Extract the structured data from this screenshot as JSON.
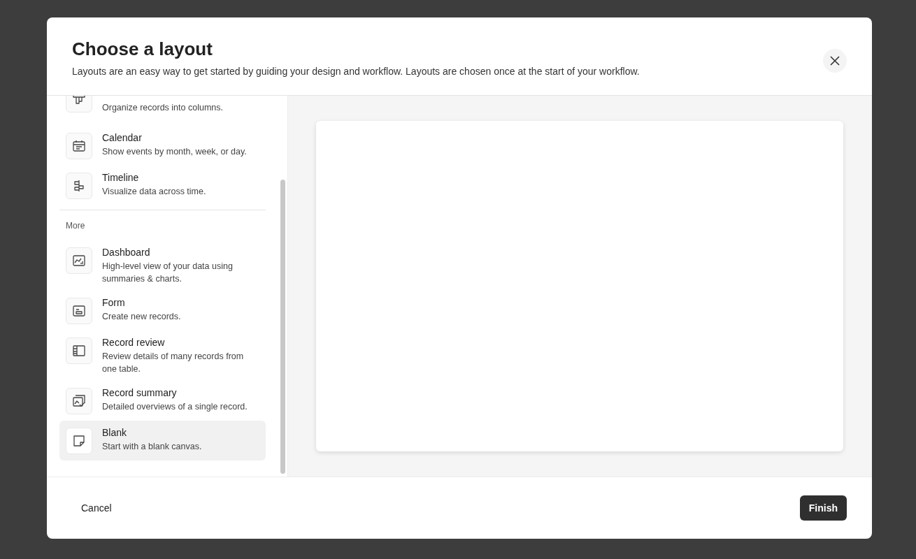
{
  "dialog": {
    "title": "Choose a layout",
    "subtitle": "Layouts are an easy way to get started by guiding your design and workflow. Layouts are chosen once at the start of your workflow."
  },
  "sections": [
    {
      "items": [
        {
          "kind": "kanban",
          "description": "Organize records into columns.",
          "selected": false
        },
        {
          "kind": "calendar",
          "title": "Calendar",
          "description": "Show events by month, week, or day.",
          "selected": false
        },
        {
          "kind": "timeline",
          "title": "Timeline",
          "description": "Visualize data across time.",
          "selected": false
        }
      ]
    },
    {
      "heading": "More",
      "items": [
        {
          "kind": "dashboard",
          "title": "Dashboard",
          "description": "High-level view of your data using summaries & charts.",
          "selected": false
        },
        {
          "kind": "form",
          "title": "Form",
          "description": "Create new records.",
          "selected": false
        },
        {
          "kind": "review",
          "title": "Record review",
          "description": "Review details of many records from one table.",
          "selected": false
        },
        {
          "kind": "summary",
          "title": "Record summary",
          "description": "Detailed overviews of a single record.",
          "selected": false
        },
        {
          "kind": "blank",
          "title": "Blank",
          "description": "Start with a blank canvas.",
          "selected": true
        }
      ]
    }
  ],
  "footer": {
    "cancel": "Cancel",
    "finish": "Finish"
  }
}
